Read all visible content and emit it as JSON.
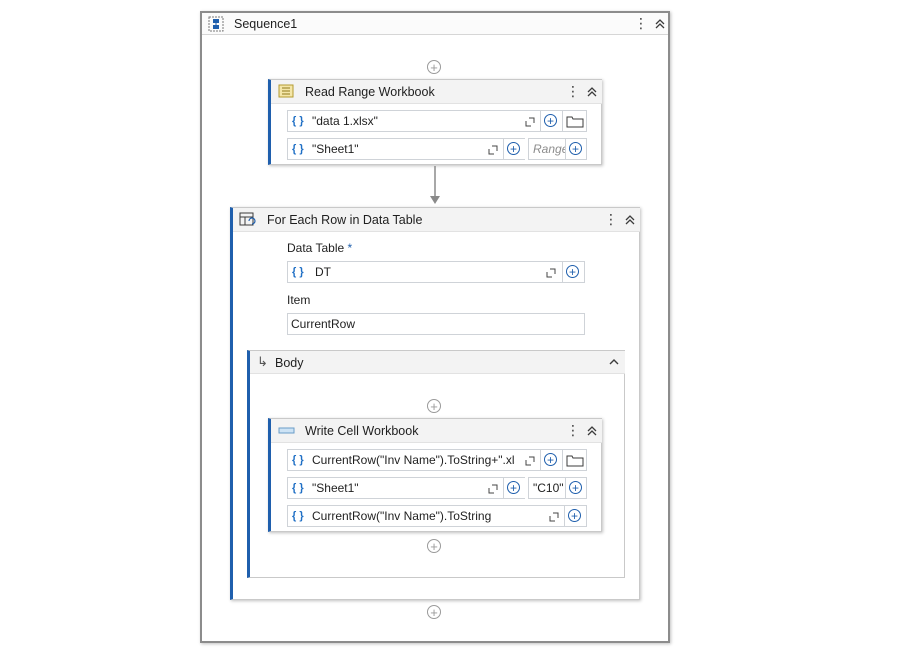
{
  "sequence": {
    "title": "Sequence1"
  },
  "read_range": {
    "title": "Read Range Workbook",
    "workbook_path": "\"data 1.xlsx\"",
    "sheet_name": "\"Sheet1\"",
    "range_placeholder": "Range"
  },
  "for_each": {
    "title": "For Each Row in Data Table",
    "data_table_label": "Data Table",
    "required_mark": "*",
    "data_table_value": "DT",
    "item_label": "Item",
    "item_value": "CurrentRow",
    "body_label": "Body"
  },
  "write_cell": {
    "title": "Write Cell Workbook",
    "workbook_path": "CurrentRow(\"Inv Name\").ToString+\".xls",
    "sheet_name": "\"Sheet1\"",
    "cell": "\"C10\"",
    "value": "CurrentRow(\"Inv Name\").ToString"
  },
  "icons": {
    "brace": "{ }",
    "plus": "+",
    "dots": "⋮",
    "collapse": "︽",
    "body_arrow": "↳",
    "chevron_up": "^"
  },
  "colors": {
    "accent": "#1f5fad",
    "brace": "#1f6fc5"
  }
}
